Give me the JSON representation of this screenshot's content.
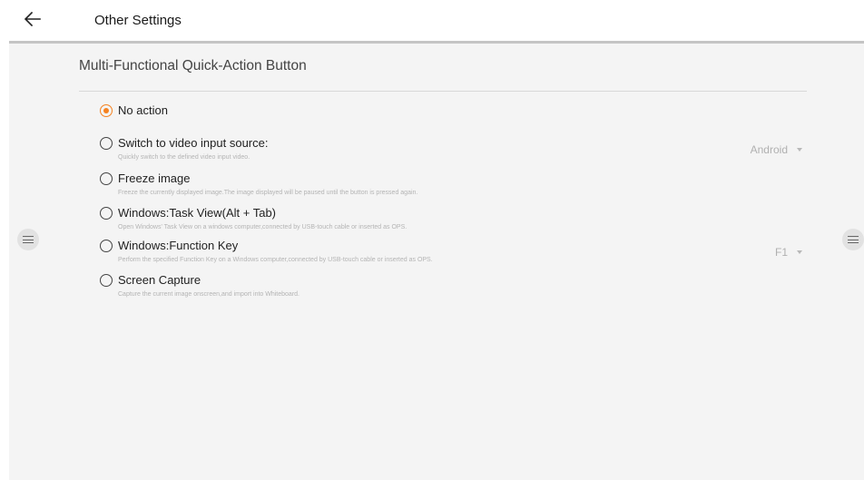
{
  "header": {
    "title": "Other Settings",
    "back_icon": "arrow-left-icon"
  },
  "section": {
    "title": "Multi-Functional Quick-Action Button"
  },
  "options": [
    {
      "label": "No action",
      "description": "",
      "selected": true
    },
    {
      "label": "Switch to video input source:",
      "description": "Quickly switch to the defined video input video.",
      "selected": false
    },
    {
      "label": "Freeze image",
      "description": "Freeze the currently displayed image.The image displayed will be paused until the button is pressed again.",
      "selected": false
    },
    {
      "label": "Windows:Task View(Alt + Tab)",
      "description": "Open Windows' Task View on a windows computer,connected by USB-touch cable or inserted as OPS.",
      "selected": false
    },
    {
      "label": "Windows:Function Key",
      "description": "Perform the specified Function Key on a Windows computer,connected by USB-touch cable or inserted as OPS.",
      "selected": false
    },
    {
      "label": "Screen Capture",
      "description": "Capture the current image onscreen,and import into Whiteboard.",
      "selected": false
    }
  ],
  "dropdowns": {
    "video_source": {
      "value": "Android"
    },
    "function_key": {
      "value": "F1"
    }
  },
  "colors": {
    "accent": "#f58220",
    "panel_background": "#f4f4f4",
    "divider": "#c4c4c4"
  }
}
